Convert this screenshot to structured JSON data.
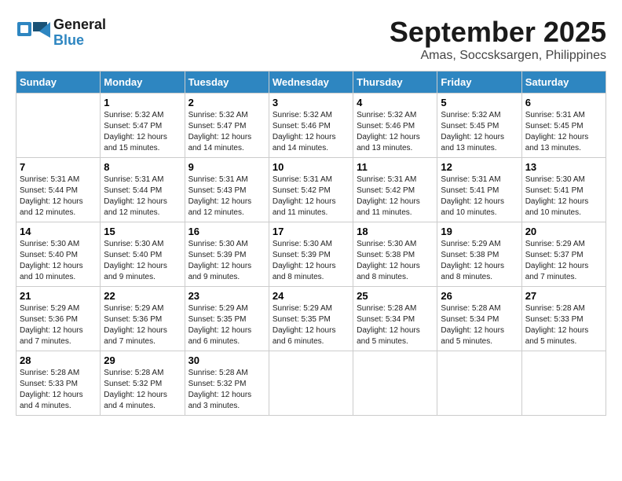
{
  "logo": {
    "text_general": "General",
    "text_blue": "Blue"
  },
  "title": "September 2025",
  "subtitle": "Amas, Soccsksargen, Philippines",
  "days_of_week": [
    "Sunday",
    "Monday",
    "Tuesday",
    "Wednesday",
    "Thursday",
    "Friday",
    "Saturday"
  ],
  "weeks": [
    [
      {
        "day": "",
        "info": ""
      },
      {
        "day": "1",
        "info": "Sunrise: 5:32 AM\nSunset: 5:47 PM\nDaylight: 12 hours\nand 15 minutes."
      },
      {
        "day": "2",
        "info": "Sunrise: 5:32 AM\nSunset: 5:47 PM\nDaylight: 12 hours\nand 14 minutes."
      },
      {
        "day": "3",
        "info": "Sunrise: 5:32 AM\nSunset: 5:46 PM\nDaylight: 12 hours\nand 14 minutes."
      },
      {
        "day": "4",
        "info": "Sunrise: 5:32 AM\nSunset: 5:46 PM\nDaylight: 12 hours\nand 13 minutes."
      },
      {
        "day": "5",
        "info": "Sunrise: 5:32 AM\nSunset: 5:45 PM\nDaylight: 12 hours\nand 13 minutes."
      },
      {
        "day": "6",
        "info": "Sunrise: 5:31 AM\nSunset: 5:45 PM\nDaylight: 12 hours\nand 13 minutes."
      }
    ],
    [
      {
        "day": "7",
        "info": "Sunrise: 5:31 AM\nSunset: 5:44 PM\nDaylight: 12 hours\nand 12 minutes."
      },
      {
        "day": "8",
        "info": "Sunrise: 5:31 AM\nSunset: 5:44 PM\nDaylight: 12 hours\nand 12 minutes."
      },
      {
        "day": "9",
        "info": "Sunrise: 5:31 AM\nSunset: 5:43 PM\nDaylight: 12 hours\nand 12 minutes."
      },
      {
        "day": "10",
        "info": "Sunrise: 5:31 AM\nSunset: 5:42 PM\nDaylight: 12 hours\nand 11 minutes."
      },
      {
        "day": "11",
        "info": "Sunrise: 5:31 AM\nSunset: 5:42 PM\nDaylight: 12 hours\nand 11 minutes."
      },
      {
        "day": "12",
        "info": "Sunrise: 5:31 AM\nSunset: 5:41 PM\nDaylight: 12 hours\nand 10 minutes."
      },
      {
        "day": "13",
        "info": "Sunrise: 5:30 AM\nSunset: 5:41 PM\nDaylight: 12 hours\nand 10 minutes."
      }
    ],
    [
      {
        "day": "14",
        "info": "Sunrise: 5:30 AM\nSunset: 5:40 PM\nDaylight: 12 hours\nand 10 minutes."
      },
      {
        "day": "15",
        "info": "Sunrise: 5:30 AM\nSunset: 5:40 PM\nDaylight: 12 hours\nand 9 minutes."
      },
      {
        "day": "16",
        "info": "Sunrise: 5:30 AM\nSunset: 5:39 PM\nDaylight: 12 hours\nand 9 minutes."
      },
      {
        "day": "17",
        "info": "Sunrise: 5:30 AM\nSunset: 5:39 PM\nDaylight: 12 hours\nand 8 minutes."
      },
      {
        "day": "18",
        "info": "Sunrise: 5:30 AM\nSunset: 5:38 PM\nDaylight: 12 hours\nand 8 minutes."
      },
      {
        "day": "19",
        "info": "Sunrise: 5:29 AM\nSunset: 5:38 PM\nDaylight: 12 hours\nand 8 minutes."
      },
      {
        "day": "20",
        "info": "Sunrise: 5:29 AM\nSunset: 5:37 PM\nDaylight: 12 hours\nand 7 minutes."
      }
    ],
    [
      {
        "day": "21",
        "info": "Sunrise: 5:29 AM\nSunset: 5:36 PM\nDaylight: 12 hours\nand 7 minutes."
      },
      {
        "day": "22",
        "info": "Sunrise: 5:29 AM\nSunset: 5:36 PM\nDaylight: 12 hours\nand 7 minutes."
      },
      {
        "day": "23",
        "info": "Sunrise: 5:29 AM\nSunset: 5:35 PM\nDaylight: 12 hours\nand 6 minutes."
      },
      {
        "day": "24",
        "info": "Sunrise: 5:29 AM\nSunset: 5:35 PM\nDaylight: 12 hours\nand 6 minutes."
      },
      {
        "day": "25",
        "info": "Sunrise: 5:28 AM\nSunset: 5:34 PM\nDaylight: 12 hours\nand 5 minutes."
      },
      {
        "day": "26",
        "info": "Sunrise: 5:28 AM\nSunset: 5:34 PM\nDaylight: 12 hours\nand 5 minutes."
      },
      {
        "day": "27",
        "info": "Sunrise: 5:28 AM\nSunset: 5:33 PM\nDaylight: 12 hours\nand 5 minutes."
      }
    ],
    [
      {
        "day": "28",
        "info": "Sunrise: 5:28 AM\nSunset: 5:33 PM\nDaylight: 12 hours\nand 4 minutes."
      },
      {
        "day": "29",
        "info": "Sunrise: 5:28 AM\nSunset: 5:32 PM\nDaylight: 12 hours\nand 4 minutes."
      },
      {
        "day": "30",
        "info": "Sunrise: 5:28 AM\nSunset: 5:32 PM\nDaylight: 12 hours\nand 3 minutes."
      },
      {
        "day": "",
        "info": ""
      },
      {
        "day": "",
        "info": ""
      },
      {
        "day": "",
        "info": ""
      },
      {
        "day": "",
        "info": ""
      }
    ]
  ]
}
